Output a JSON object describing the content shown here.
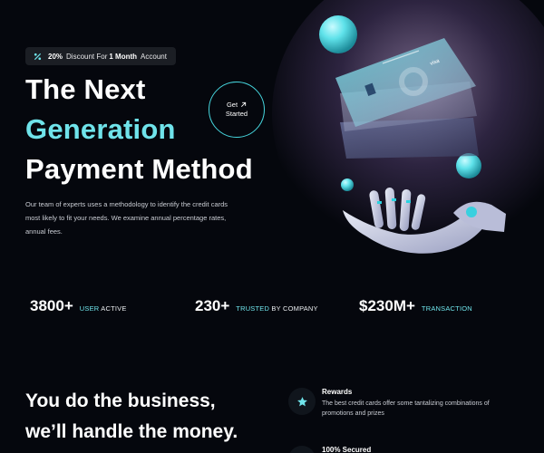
{
  "hero": {
    "badge": {
      "percent": "20%",
      "middle": "Discount For",
      "period": "1 Month",
      "suffix": "Account"
    },
    "title_line1": "The Next",
    "title_line2": "Generation",
    "title_line3": "Payment Method",
    "cta_line1": "Get",
    "cta_line2": "Started",
    "description": "Our team of experts uses a methodology to identify the credit cards most likely to fit your needs. We examine annual percentage rates, annual fees."
  },
  "card_brand": "visa",
  "stats": [
    {
      "value": "3800+",
      "label_highlight": "USER",
      "label_rest": "ACTIVE"
    },
    {
      "value": "230+",
      "label_highlight": "TRUSTED",
      "label_rest": "BY COMPANY"
    },
    {
      "value": "$230M+",
      "label_highlight": "TRANSACTION",
      "label_rest": ""
    }
  ],
  "section2": {
    "title_line1": "You do the business,",
    "title_line2": "we’ll handle the money.",
    "features": [
      {
        "icon": "star-icon",
        "title": "Rewards",
        "description": "The best credit cards offer some tantalizing combinations of promotions and prizes"
      },
      {
        "icon": "shield-icon",
        "title": "100% Secured",
        "description": ""
      }
    ]
  },
  "colors": {
    "background": "#05070d",
    "accent": "#6fe3ea",
    "cta_border": "#46d6de"
  }
}
